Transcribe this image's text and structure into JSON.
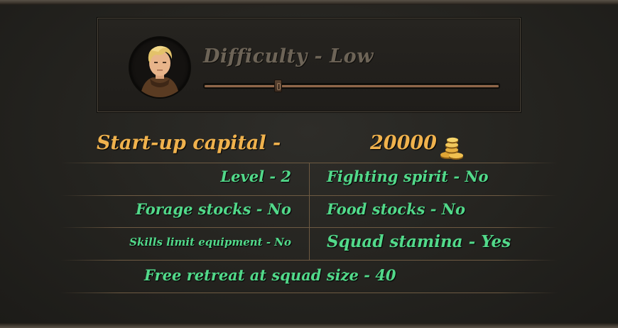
{
  "difficulty": {
    "label": "Difficulty - Low",
    "level_fraction": 0.25
  },
  "capital": {
    "label": "Start-up capital -",
    "value": "20000",
    "icon": "gold-coins-icon"
  },
  "settings": {
    "level": "Level - 2",
    "fighting_spirit": "Fighting spirit - No",
    "forage_stocks": "Forage stocks - No",
    "food_stocks": "Food stocks - No",
    "skills_limit": "Skills limit equipment - No",
    "squad_stamina": "Squad stamina - Yes",
    "free_retreat": "Free retreat at squad size - 40"
  },
  "colors": {
    "gold": "#f0b24d",
    "green": "#52d98a",
    "title_grey": "#6d6457"
  }
}
